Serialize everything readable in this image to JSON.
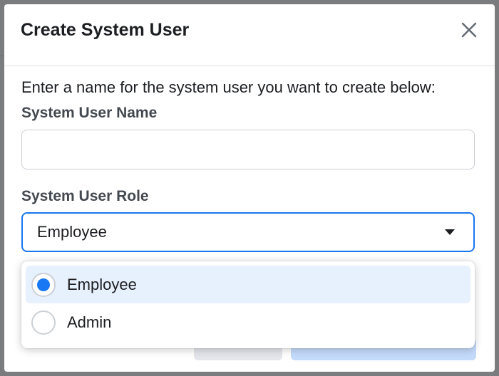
{
  "dialog": {
    "title": "Create System User",
    "close_icon": "close-icon",
    "instructions": "Enter a name for the system user you want to create below:"
  },
  "name_field": {
    "label": "System User Name",
    "value": "",
    "placeholder": ""
  },
  "role_field": {
    "label": "System User Role",
    "selected": "Employee",
    "options": [
      {
        "label": "Employee",
        "selected": true
      },
      {
        "label": "Admin",
        "selected": false
      }
    ]
  },
  "colors": {
    "accent": "#1877f2",
    "selected_option_bg": "#e7f0fd"
  }
}
